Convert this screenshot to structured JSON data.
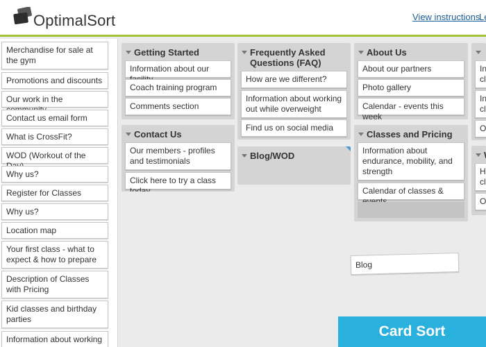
{
  "app": {
    "name": "OptimalSort"
  },
  "header": {
    "view_instructions": "View instructions",
    "leave_link": "Le"
  },
  "left_cards": [
    "Merchandise for sale at the gym",
    "Promotions and discounts",
    "Our work in the community",
    "Contact us email form",
    "What is CrossFit?",
    "WOD (Workout of the Day)",
    "Why us?",
    "Register for Classes",
    "Why us?",
    "Location map",
    "Your first class - what to expect & how to prepare",
    "Description of Classes with Pricing",
    "Kid classes and birthday parties",
    "Information about working"
  ],
  "groups": {
    "getting_started": {
      "title": "Getting Started",
      "cards": [
        "Information about our facility",
        "Coach training program",
        "Comments section"
      ]
    },
    "contact_us": {
      "title": "Contact Us",
      "cards": [
        "Our members - profiles and testimonials",
        "Click here to try a class today"
      ]
    },
    "faq": {
      "title": "Frequently Asked Questions (FAQ)",
      "cards": [
        "How are we different?",
        "Information about working out while overweight",
        "Find us on social media"
      ]
    },
    "blog": {
      "title": "Blog/WOD",
      "cards": []
    },
    "about_us": {
      "title": "About Us",
      "cards": [
        "About our partners",
        "Photo gallery",
        "Calendar - events this week"
      ]
    },
    "classes_pricing": {
      "title": "Classes and Pricing",
      "cards": [
        "Information about endurance, mobility, and strength",
        "Calendar of classes & events"
      ]
    },
    "partial_1": {
      "cards": [
        "Int cla",
        "Inf cla",
        "Ou"
      ]
    },
    "partial_2": {
      "title": "W",
      "cards": [
        "Ho cla",
        "Ou"
      ]
    }
  },
  "floating_card": "Blog",
  "badge": "Card Sort",
  "colors": {
    "accent_line": "#a6c13a",
    "badge": "#29b0dc",
    "link": "#1a5d9b",
    "group_bg": "#d4d4d4"
  }
}
